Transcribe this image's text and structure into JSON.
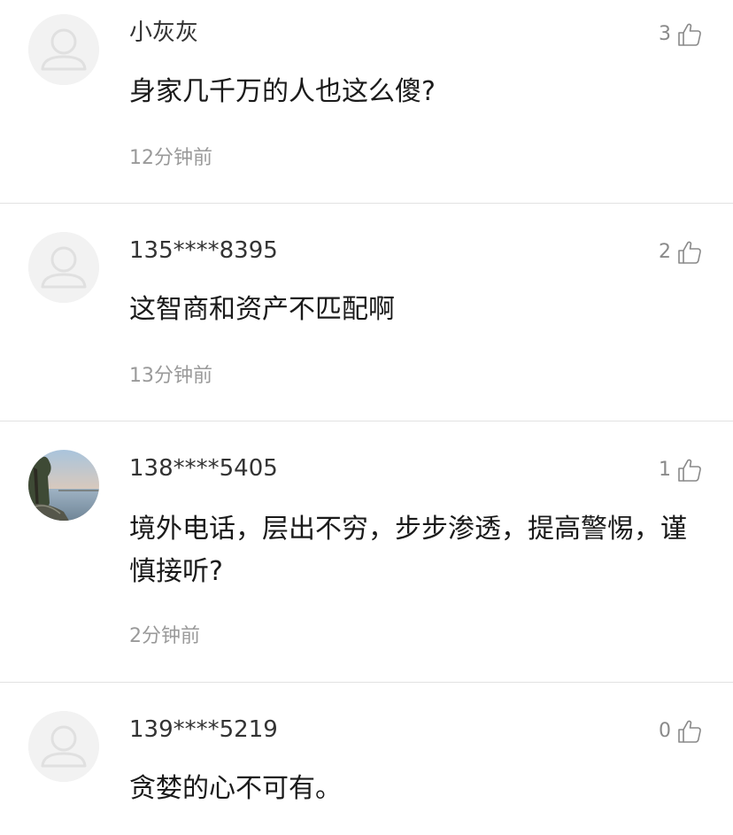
{
  "comments": [
    {
      "username": "小灰灰",
      "text": "身家几千万的人也这么傻?",
      "time": "12分钟前",
      "likes": "3",
      "avatar": "default-avatar"
    },
    {
      "username": "135****8395",
      "text": "这智商和资产不匹配啊",
      "time": "13分钟前",
      "likes": "2",
      "avatar": "default-avatar"
    },
    {
      "username": "138****5405",
      "text": "境外电话，层出不穷，步步渗透，提高警惕，谨慎接听?",
      "time": "2分钟前",
      "likes": "1",
      "avatar": "landscape-photo-avatar"
    },
    {
      "username": "139****5219",
      "text": "贪婪的心不可有。",
      "time": "",
      "likes": "0",
      "avatar": "default-avatar"
    }
  ],
  "colors": {
    "text": "#1a1a1a",
    "username": "#333333",
    "meta": "#9a9a9a",
    "divider": "#e2e2e2",
    "avatar_bg": "#f2f2f2"
  }
}
